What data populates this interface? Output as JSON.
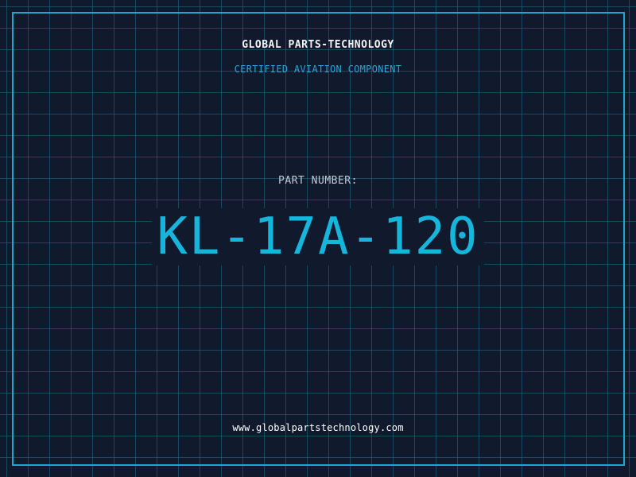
{
  "header": {
    "brand": "GLOBAL PARTS-TECHNOLOGY",
    "tagline": "CERTIFIED AVIATION COMPONENT"
  },
  "part": {
    "label": "PART NUMBER:",
    "number": "KL-17A-120"
  },
  "footer": {
    "url": "www.globalpartstechnology.com"
  },
  "colors": {
    "background": "#101a2c",
    "grid": "#216e8c",
    "frame": "#1aa8cc",
    "accent": "#16b6dc",
    "tagline": "#2aa3d6",
    "text": "#f2f4f7",
    "muted": "#c3c9d4"
  }
}
